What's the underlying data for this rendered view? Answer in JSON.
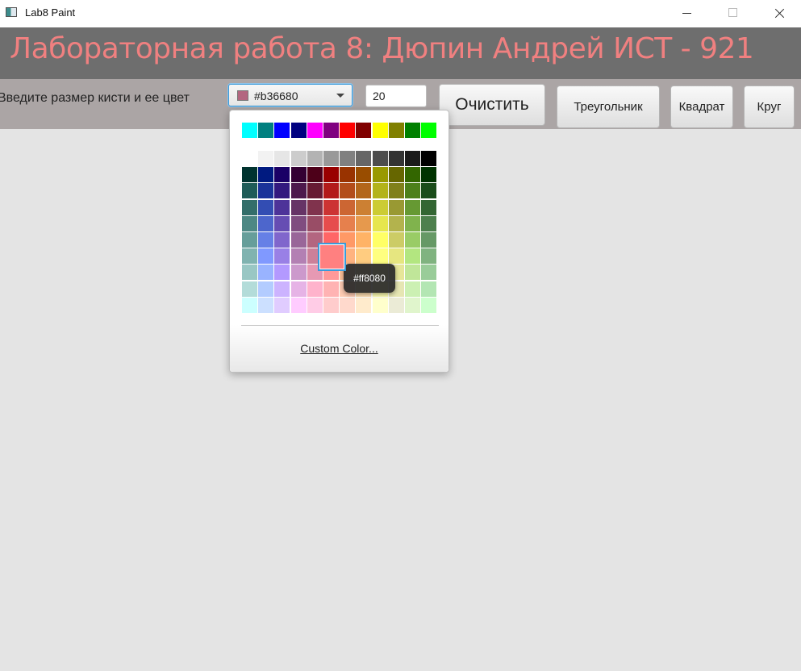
{
  "window": {
    "title": "Lab8 Paint"
  },
  "header": {
    "title": "Лабораторная работа 8: Дюпин Андрей ИСТ - 921"
  },
  "toolbar": {
    "brush_label": "Введите размер кисти и ее цвет",
    "color_picker": {
      "value": "#b36680",
      "swatch_color": "#b36680"
    },
    "size_value": "20",
    "clear_label": "Очистить",
    "triangle_label": "Треугольник",
    "square_label": "Квадрат",
    "circle_label": "Круг"
  },
  "palette": {
    "top_row": [
      "#00ffff",
      "#008080",
      "#0000ff",
      "#000080",
      "#ff00ff",
      "#800080",
      "#ff0000",
      "#800000",
      "#ffff00",
      "#808000",
      "#008000",
      "#00ff00"
    ],
    "grid": [
      [
        "#ffffff",
        "#f2f2f2",
        "#e6e6e6",
        "#cccccc",
        "#b3b3b3",
        "#999999",
        "#808080",
        "#666666",
        "#4d4d4d",
        "#333333",
        "#1a1a1a",
        "#000000"
      ],
      [
        "#00332f",
        "#001a80",
        "#1a0066",
        "#330033",
        "#4d0019",
        "#990000",
        "#993300",
        "#994d00",
        "#999900",
        "#666600",
        "#336600",
        "#003300"
      ],
      [
        "#1f5c58",
        "#1a3399",
        "#33197f",
        "#4d194d",
        "#661a33",
        "#b31a1a",
        "#b34d1a",
        "#b3661a",
        "#b3b31a",
        "#80801a",
        "#4d801a",
        "#1a4d1a"
      ],
      [
        "#336e6a",
        "#334db3",
        "#4d3399",
        "#663366",
        "#80334d",
        "#cc3333",
        "#cc6633",
        "#cc8033",
        "#cccc33",
        "#999933",
        "#669933",
        "#336633"
      ],
      [
        "#4d8884",
        "#4d66cc",
        "#664db3",
        "#804d80",
        "#994d66",
        "#e64d4d",
        "#e6804d",
        "#e6994d",
        "#e6e64d",
        "#b3b34d",
        "#80b34d",
        "#4d804d"
      ],
      [
        "#669e9a",
        "#6680e6",
        "#8066cc",
        "#996699",
        "#b36680",
        "#ff6666",
        "#ff9966",
        "#ffb366",
        "#ffff66",
        "#cccc66",
        "#99cc66",
        "#669966"
      ],
      [
        "#80b3b0",
        "#8099ff",
        "#9980e6",
        "#b380b3",
        "#cc8099",
        "#ff8080",
        "#ffb380",
        "#ffcc80",
        "#ffff80",
        "#e6e680",
        "#b3e680",
        "#80b380"
      ],
      [
        "#99c7c4",
        "#99b3ff",
        "#b399ff",
        "#cc99cc",
        "#e699b3",
        "#ff9999",
        "#ffc099",
        "#ffd699",
        "#ffff99",
        "#e6e699",
        "#c0e699",
        "#99cc99"
      ],
      [
        "#b3dcd9",
        "#b3ccff",
        "#ccb3ff",
        "#e6b3e6",
        "#ffb3cc",
        "#ffb3b3",
        "#ffccb3",
        "#ffe0b3",
        "#ffffb3",
        "#e6e6b3",
        "#ccf0b3",
        "#b3e6b3"
      ],
      [
        "#ccffff",
        "#cce0ff",
        "#e0ccff",
        "#ffccff",
        "#ffcce6",
        "#ffcccc",
        "#ffd9cc",
        "#ffebcc",
        "#ffffcc",
        "#ebebd6",
        "#e0f5cc",
        "#ccffcc"
      ]
    ],
    "selected": {
      "row": 6,
      "col": 5
    },
    "tooltip": "#ff8080",
    "custom_color_label": "Custom Color..."
  }
}
